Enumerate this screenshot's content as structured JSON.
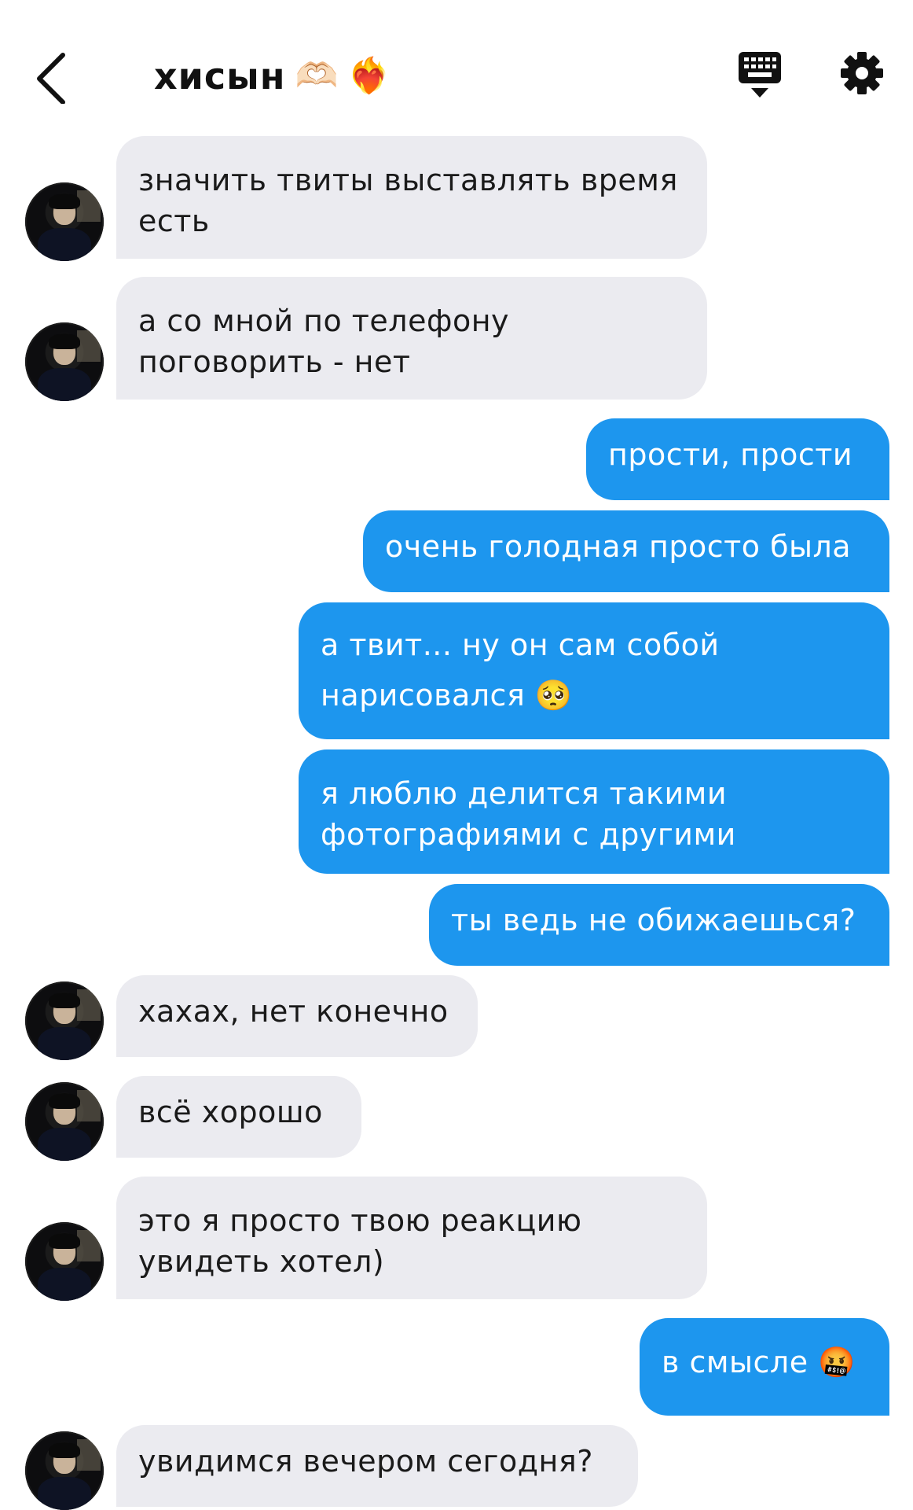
{
  "header": {
    "title": "хисын",
    "emoji_1": "🫶🏻",
    "emoji_2": "❤️‍🔥"
  },
  "messages": [
    {
      "side": "in",
      "text": "значить твиты выставлять время есть"
    },
    {
      "side": "in",
      "text": "а со мной по телефону поговорить - нет"
    },
    {
      "side": "out",
      "text": "прости, прости"
    },
    {
      "side": "out",
      "text": "очень голодная просто была"
    },
    {
      "side": "out",
      "text": "а твит... ну он сам собой нарисовался 🥺"
    },
    {
      "side": "out",
      "text": "я люблю делится такими фотографиями с другими"
    },
    {
      "side": "out",
      "text": "ты ведь не обижаешься?"
    },
    {
      "side": "in",
      "text": "хахах, нет конечно"
    },
    {
      "side": "in",
      "text": "всё хорошо"
    },
    {
      "side": "in",
      "text": "это я просто твою реакцию увидеть хотел)"
    },
    {
      "side": "out",
      "text": "в смысле 🤬"
    },
    {
      "side": "in",
      "text": "увидимся вечером сегодня?"
    }
  ],
  "colors": {
    "outgoing": "#1d96ee",
    "incoming": "#ebebf0"
  }
}
